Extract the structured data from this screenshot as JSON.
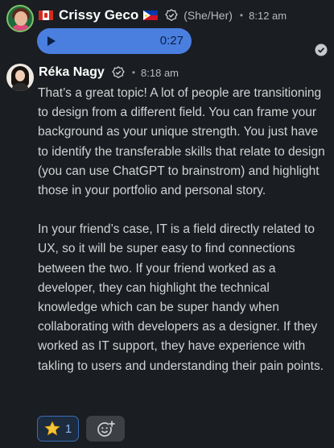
{
  "message1": {
    "author": "Crissy Geco",
    "pronouns": "(She/Her)",
    "separator": "•",
    "time": "8:12 am",
    "voice_duration": "0:27",
    "icons": [
      "canada-flag-icon",
      "philippines-flag-icon",
      "verified-badge-icon",
      "play-icon",
      "sent-check-icon"
    ]
  },
  "message2": {
    "author": "Réka Nagy",
    "separator": "•",
    "time": "8:18 am",
    "paragraphs": [
      "That’s a great topic! A lot of people are transitioning to design from a different field. You can frame your background as your unique strength. You just have to identify the transferable skills that relate to design (you can use ChatGPT to brainstrom) and highlight those in your portfolio and personal story.",
      "In your friend’s case, IT is a field directly related to UX, so it will be super easy to find connections between the two. If your friend worked as a developer, they can highlight the technical knowledge which can be super handy when collaborating with developers as a designer. If they worked as IT support, they have experience with takling to users and understanding their pain points."
    ],
    "reactions": [
      {
        "emoji": "star-emoji-icon",
        "count": "1"
      }
    ],
    "add_reaction_icon": "add-reaction-icon"
  },
  "colors": {
    "background": "#1a1d21",
    "voice_bubble": "#4a7fe0",
    "reaction_border": "#3a6db5"
  }
}
